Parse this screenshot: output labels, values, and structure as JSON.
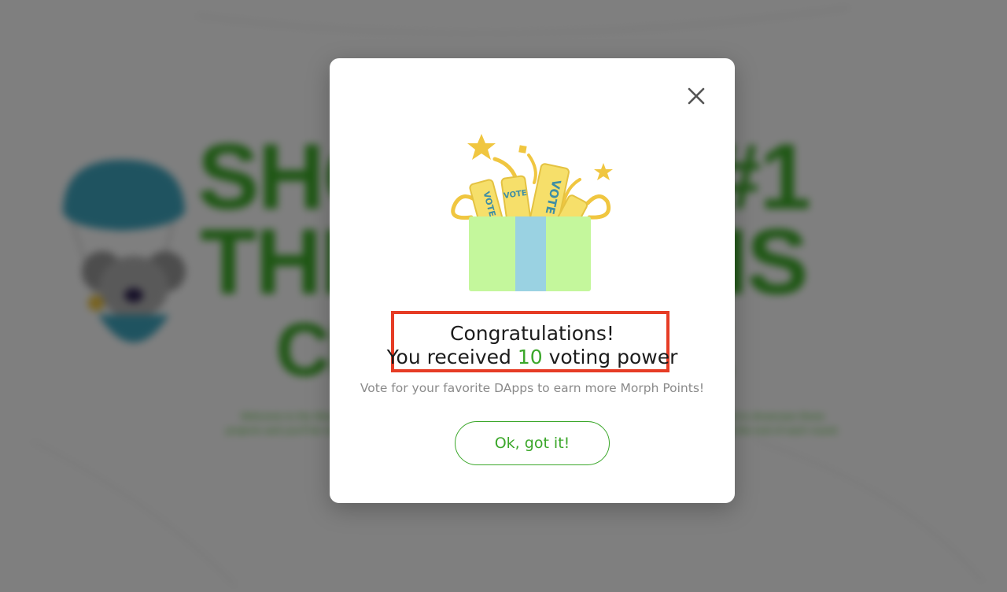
{
  "background": {
    "hero_line_1": "SHOW THE #1",
    "hero_line_2": "THE GENESIS",
    "hero_line_3": "CHALLENGE",
    "description": "Welcome to the Morph Genesis Challenge, where you'll discover the best of exciting new DApps. We're proud to showcase these projects and you'll be rewarded with Morph Points, a symbol of your support. Voting power will be recalculated at the end of each round."
  },
  "modal": {
    "close_icon": "close-icon",
    "gift_icon": "gift-box-with-vote-tickets-icon",
    "congrats": "Congratulations!",
    "received_prefix": "You received",
    "voting_power": "10",
    "received_suffix": "voting power",
    "subtitle": "Vote for your favorite DApps to earn more Morph Points!",
    "ok_button": "Ok, got it!"
  },
  "colors": {
    "accent_green": "#3ba72a",
    "highlight_red": "#e63c25",
    "gift_green": "#c4f79c",
    "gift_ribbon": "#9ad2e2",
    "ticket_yellow": "#f6df6a",
    "streamer_gold": "#f0c640"
  }
}
